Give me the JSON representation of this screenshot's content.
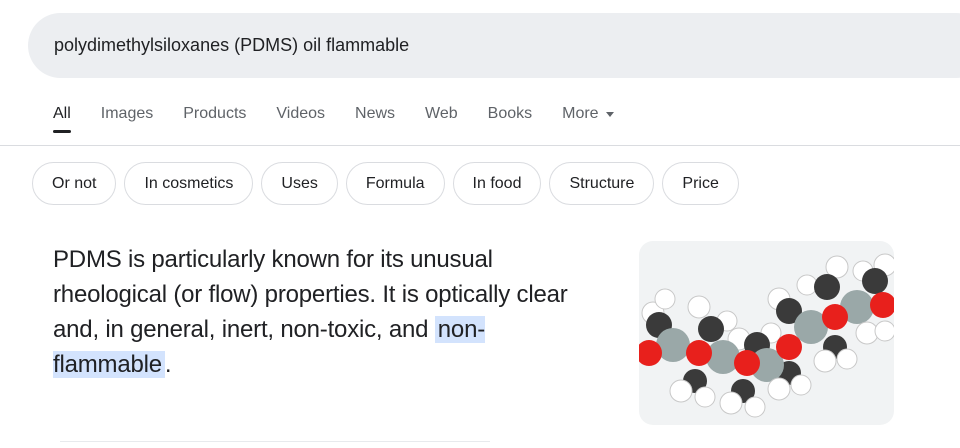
{
  "search": {
    "query": "polydimethylsiloxanes (PDMS) oil flammable"
  },
  "tabs": [
    {
      "label": "All"
    },
    {
      "label": "Images"
    },
    {
      "label": "Products"
    },
    {
      "label": "Videos"
    },
    {
      "label": "News"
    },
    {
      "label": "Web"
    },
    {
      "label": "Books"
    },
    {
      "label": "More"
    }
  ],
  "chips": [
    {
      "label": "Or not"
    },
    {
      "label": "In cosmetics"
    },
    {
      "label": "Uses"
    },
    {
      "label": "Formula"
    },
    {
      "label": "In food"
    },
    {
      "label": "Structure"
    },
    {
      "label": "Price"
    }
  ],
  "snippet": {
    "text_before": "PDMS is particularly known for its unusual rheological (or flow) properties. It is optically clear and, in general, inert, non-toxic, and",
    "highlight": "non-flammable",
    "text_after": "."
  },
  "thumbnail": {
    "icon": "pdms-molecule-model"
  },
  "colors": {
    "highlight": "#d3e3fd",
    "searchbar": "#eceef1",
    "oxygen": "#e8201c",
    "silicon": "#9aa8a8",
    "carbon": "#333333",
    "hydrogen": "#ffffff"
  }
}
